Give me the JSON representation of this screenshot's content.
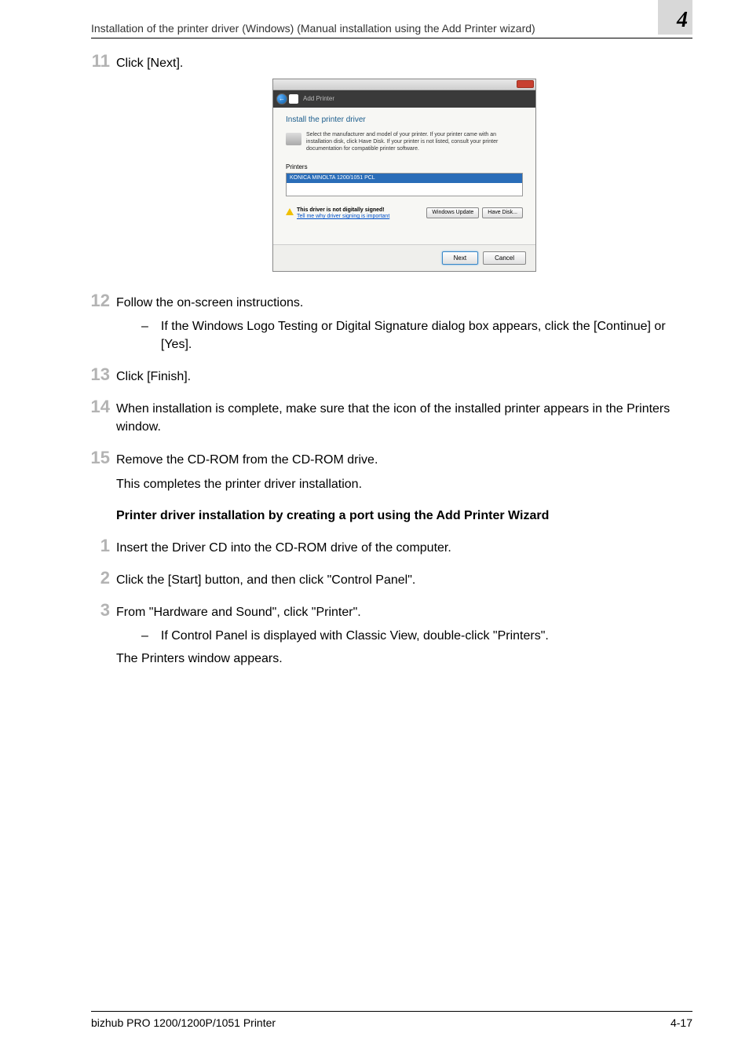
{
  "header": {
    "title": "Installation of the printer driver (Windows) (Manual installation using the Add Printer wizard)",
    "chapter_number": "4"
  },
  "steps": {
    "s11": {
      "num": "11",
      "text": "Click [Next]."
    },
    "s12": {
      "num": "12",
      "text": "Follow the on-screen instructions.",
      "sub": "If the Windows Logo Testing or Digital Signature dialog box appears, click the [Continue] or [Yes]."
    },
    "s13": {
      "num": "13",
      "text": "Click [Finish]."
    },
    "s14": {
      "num": "14",
      "text": "When installation is complete, make sure that the icon of the installed printer appears in the Printers window."
    },
    "s15": {
      "num": "15",
      "text": "Remove the CD-ROM from the CD-ROM drive.",
      "extra": "This completes the printer driver installation."
    }
  },
  "section_title": "Printer driver installation by creating a port using the Add Printer Wizard",
  "steps2": {
    "s1": {
      "num": "1",
      "text": "Insert the Driver CD into the CD-ROM drive of the computer."
    },
    "s2": {
      "num": "2",
      "text": "Click the [Start] button, and then click \"Control Panel\"."
    },
    "s3": {
      "num": "3",
      "text": "From \"Hardware and Sound\", click \"Printer\".",
      "sub": "If Control Panel is displayed with Classic View, double-click \"Printers\".",
      "after": "The Printers window appears."
    }
  },
  "dialog": {
    "nav_text": "Add Printer",
    "heading": "Install the printer driver",
    "desc": "Select the manufacturer and model of your printer. If your printer came with an installation disk, click Have Disk. If your printer is not listed, consult your printer documentation for compatible printer software.",
    "printers_label": "Printers",
    "selected_printer": "KONICA MINOLTA 1200/1051 PCL",
    "signing_bold": "This driver is not digitally signed!",
    "signing_link": "Tell me why driver signing is important",
    "btn_windows_update": "Windows Update",
    "btn_have_disk": "Have Disk...",
    "btn_next": "Next",
    "btn_cancel": "Cancel"
  },
  "footer": {
    "product": "bizhub PRO 1200/1200P/1051 Printer",
    "page": "4-17"
  }
}
